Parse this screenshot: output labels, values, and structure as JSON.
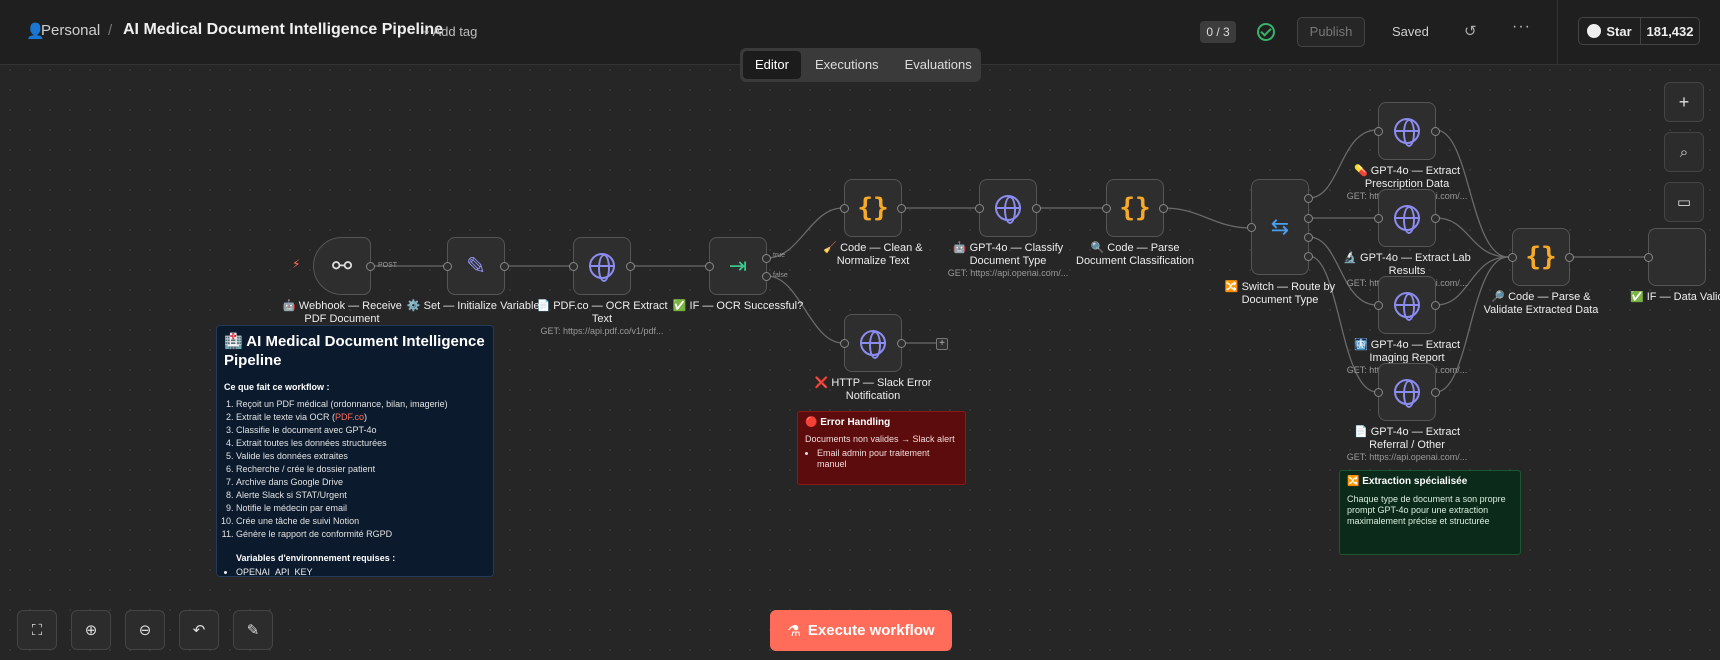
{
  "header": {
    "workspace": "Personal",
    "workflow_title": "AI Medical Document Intelligence Pipeline",
    "add_tag": "+ Add tag",
    "counter": "0 / 3",
    "publish": "Publish",
    "saved": "Saved",
    "github_star": "Star",
    "github_count": "181,432"
  },
  "tabs": [
    "Editor",
    "Executions",
    "Evaluations"
  ],
  "execute_button": "Execute workflow",
  "edge_labels": {
    "post": "POST",
    "true": "true",
    "false": "false"
  },
  "nodes": [
    {
      "label": "🤖 Webhook — Receive PDF Document",
      "sub": ""
    },
    {
      "label": "⚙️ Set — Initialize Variables",
      "sub": ""
    },
    {
      "label": "📄 PDF.co — OCR Extract Text",
      "sub": "GET: https://api.pdf.co/v1/pdf..."
    },
    {
      "label": "✅ IF — OCR Successful?",
      "sub": ""
    },
    {
      "label": "🧹 Code — Clean & Normalize Text",
      "sub": ""
    },
    {
      "label": "🤖 GPT-4o — Classify Document Type",
      "sub": "GET: https://api.openai.com/..."
    },
    {
      "label": "🔍 Code — Parse Document Classification",
      "sub": ""
    },
    {
      "label": "🔀 Switch — Route by Document Type",
      "sub": ""
    },
    {
      "label": "💊 GPT-4o — Extract Prescription Data",
      "sub": "GET: https://api.openai.com/..."
    },
    {
      "label": "🔬 GPT-4o — Extract Lab Results",
      "sub": "GET: https://api.openai.com/..."
    },
    {
      "label": "🩻 GPT-4o — Extract Imaging Report",
      "sub": "GET: https://api.openai.com/..."
    },
    {
      "label": "📄 GPT-4o — Extract Referral / Other",
      "sub": "GET: https://api.openai.com/..."
    },
    {
      "label": "🔎 Code — Parse & Validate Extracted Data",
      "sub": ""
    },
    {
      "label": "✅ IF — Data Valid?",
      "sub": ""
    },
    {
      "label": "❌ HTTP — Slack Error Notification",
      "sub": ""
    }
  ],
  "sticky_main": {
    "title": "🏥 AI Medical Document Intelligence Pipeline",
    "section": "Ce que fait ce workflow :",
    "steps": [
      "Reçoit un PDF médical (ordonnance, bilan, imagerie)",
      "Extrait le texte via OCR (",
      "Classifie le document avec GPT-4o",
      "Extrait toutes les données structurées",
      "Valide les données extraites",
      "Recherche / crée le dossier patient",
      "Archive dans Google Drive",
      "Alerte Slack si STAT/Urgent",
      "Notifie le médecin par email",
      "Crée une tâche de suivi Notion",
      "Génère le rapport de conformité RGPD"
    ],
    "ocr_link": "PDF.co",
    "ocr_suffix": ")",
    "env_title": "Variables d'environnement requises :",
    "env_items": [
      "OPENAI_API_KEY"
    ]
  },
  "sticky_error": {
    "title": "🔴 Error Handling",
    "text": "Documents non valides → Slack alert",
    "items": [
      "Email admin pour traitement manuel"
    ]
  },
  "sticky_extract": {
    "title": "🔀 Extraction spécialisée",
    "text": "Chaque type de document a son propre prompt GPT-4o pour une extraction maximalement précise et structurée"
  },
  "colors": {
    "accent": "#ff6d5a",
    "code": "#f7a928",
    "http": "#8c8cf0",
    "if": "#3ac78c",
    "switch": "#4a9ff0"
  }
}
